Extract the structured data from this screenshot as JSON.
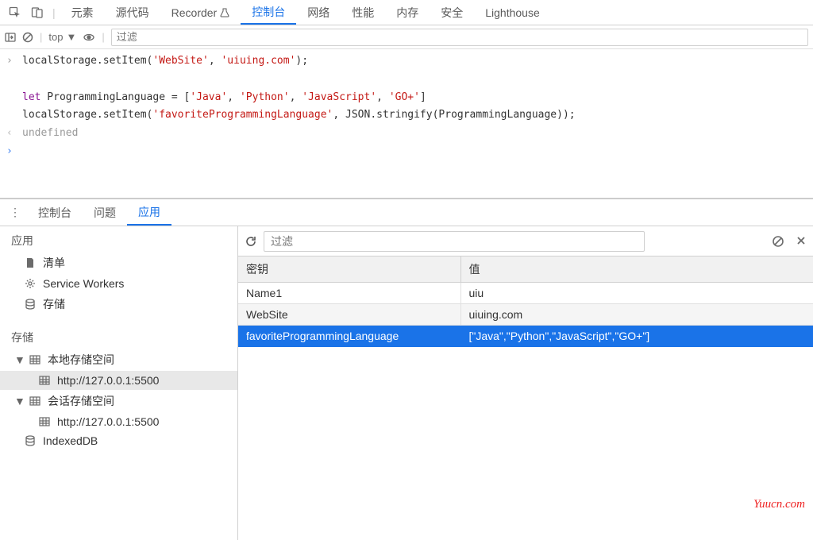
{
  "top_tabs": {
    "elements": "元素",
    "sources": "源代码",
    "recorder": "Recorder",
    "console": "控制台",
    "network": "网络",
    "performance": "性能",
    "memory": "内存",
    "security": "安全",
    "lighthouse": "Lighthouse"
  },
  "console_toolbar": {
    "context": "top",
    "filter_placeholder": "过滤"
  },
  "console_lines": {
    "l1_pre": "localStorage",
    "l1_mid1": ".setItem(",
    "l1_s1": "'WebSite'",
    "l1_mid2": ", ",
    "l1_s2": "'uiuing.com'",
    "l1_end": ");",
    "l2_kw": "let",
    "l2_var": " ProgrammingLanguage = [",
    "l2_a1": "'Java'",
    "l2_c": ", ",
    "l2_a2": "'Python'",
    "l2_a3": "'JavaScript'",
    "l2_a4": "'GO+'",
    "l2_end": "]",
    "l3_pre": "localStorage",
    "l3_mid1": ".setItem(",
    "l3_s1": "'favoriteProgrammingLanguage'",
    "l3_mid2": ", JSON.stringify(ProgrammingLanguage));",
    "undef": "undefined"
  },
  "drawer_tabs": {
    "console": "控制台",
    "issues": "问题",
    "application": "应用"
  },
  "sidebar": {
    "section_app": "应用",
    "manifest": "清单",
    "service_workers": "Service Workers",
    "storage": "存储",
    "section_storage": "存储",
    "local_storage": "本地存储空间",
    "local_storage_url": "http://127.0.0.1:5500",
    "session_storage": "会话存储空间",
    "session_storage_url": "http://127.0.0.1:5500",
    "indexeddb": "IndexedDB"
  },
  "content": {
    "filter_placeholder": "过滤",
    "col_key": "密钥",
    "col_value": "值",
    "rows": [
      {
        "key": "Name1",
        "value": "uiu"
      },
      {
        "key": "WebSite",
        "value": "uiuing.com"
      },
      {
        "key": "favoriteProgrammingLanguage",
        "value": "[\"Java\",\"Python\",\"JavaScript\",\"GO+\"]"
      }
    ]
  },
  "watermark": "Yuucn.com"
}
